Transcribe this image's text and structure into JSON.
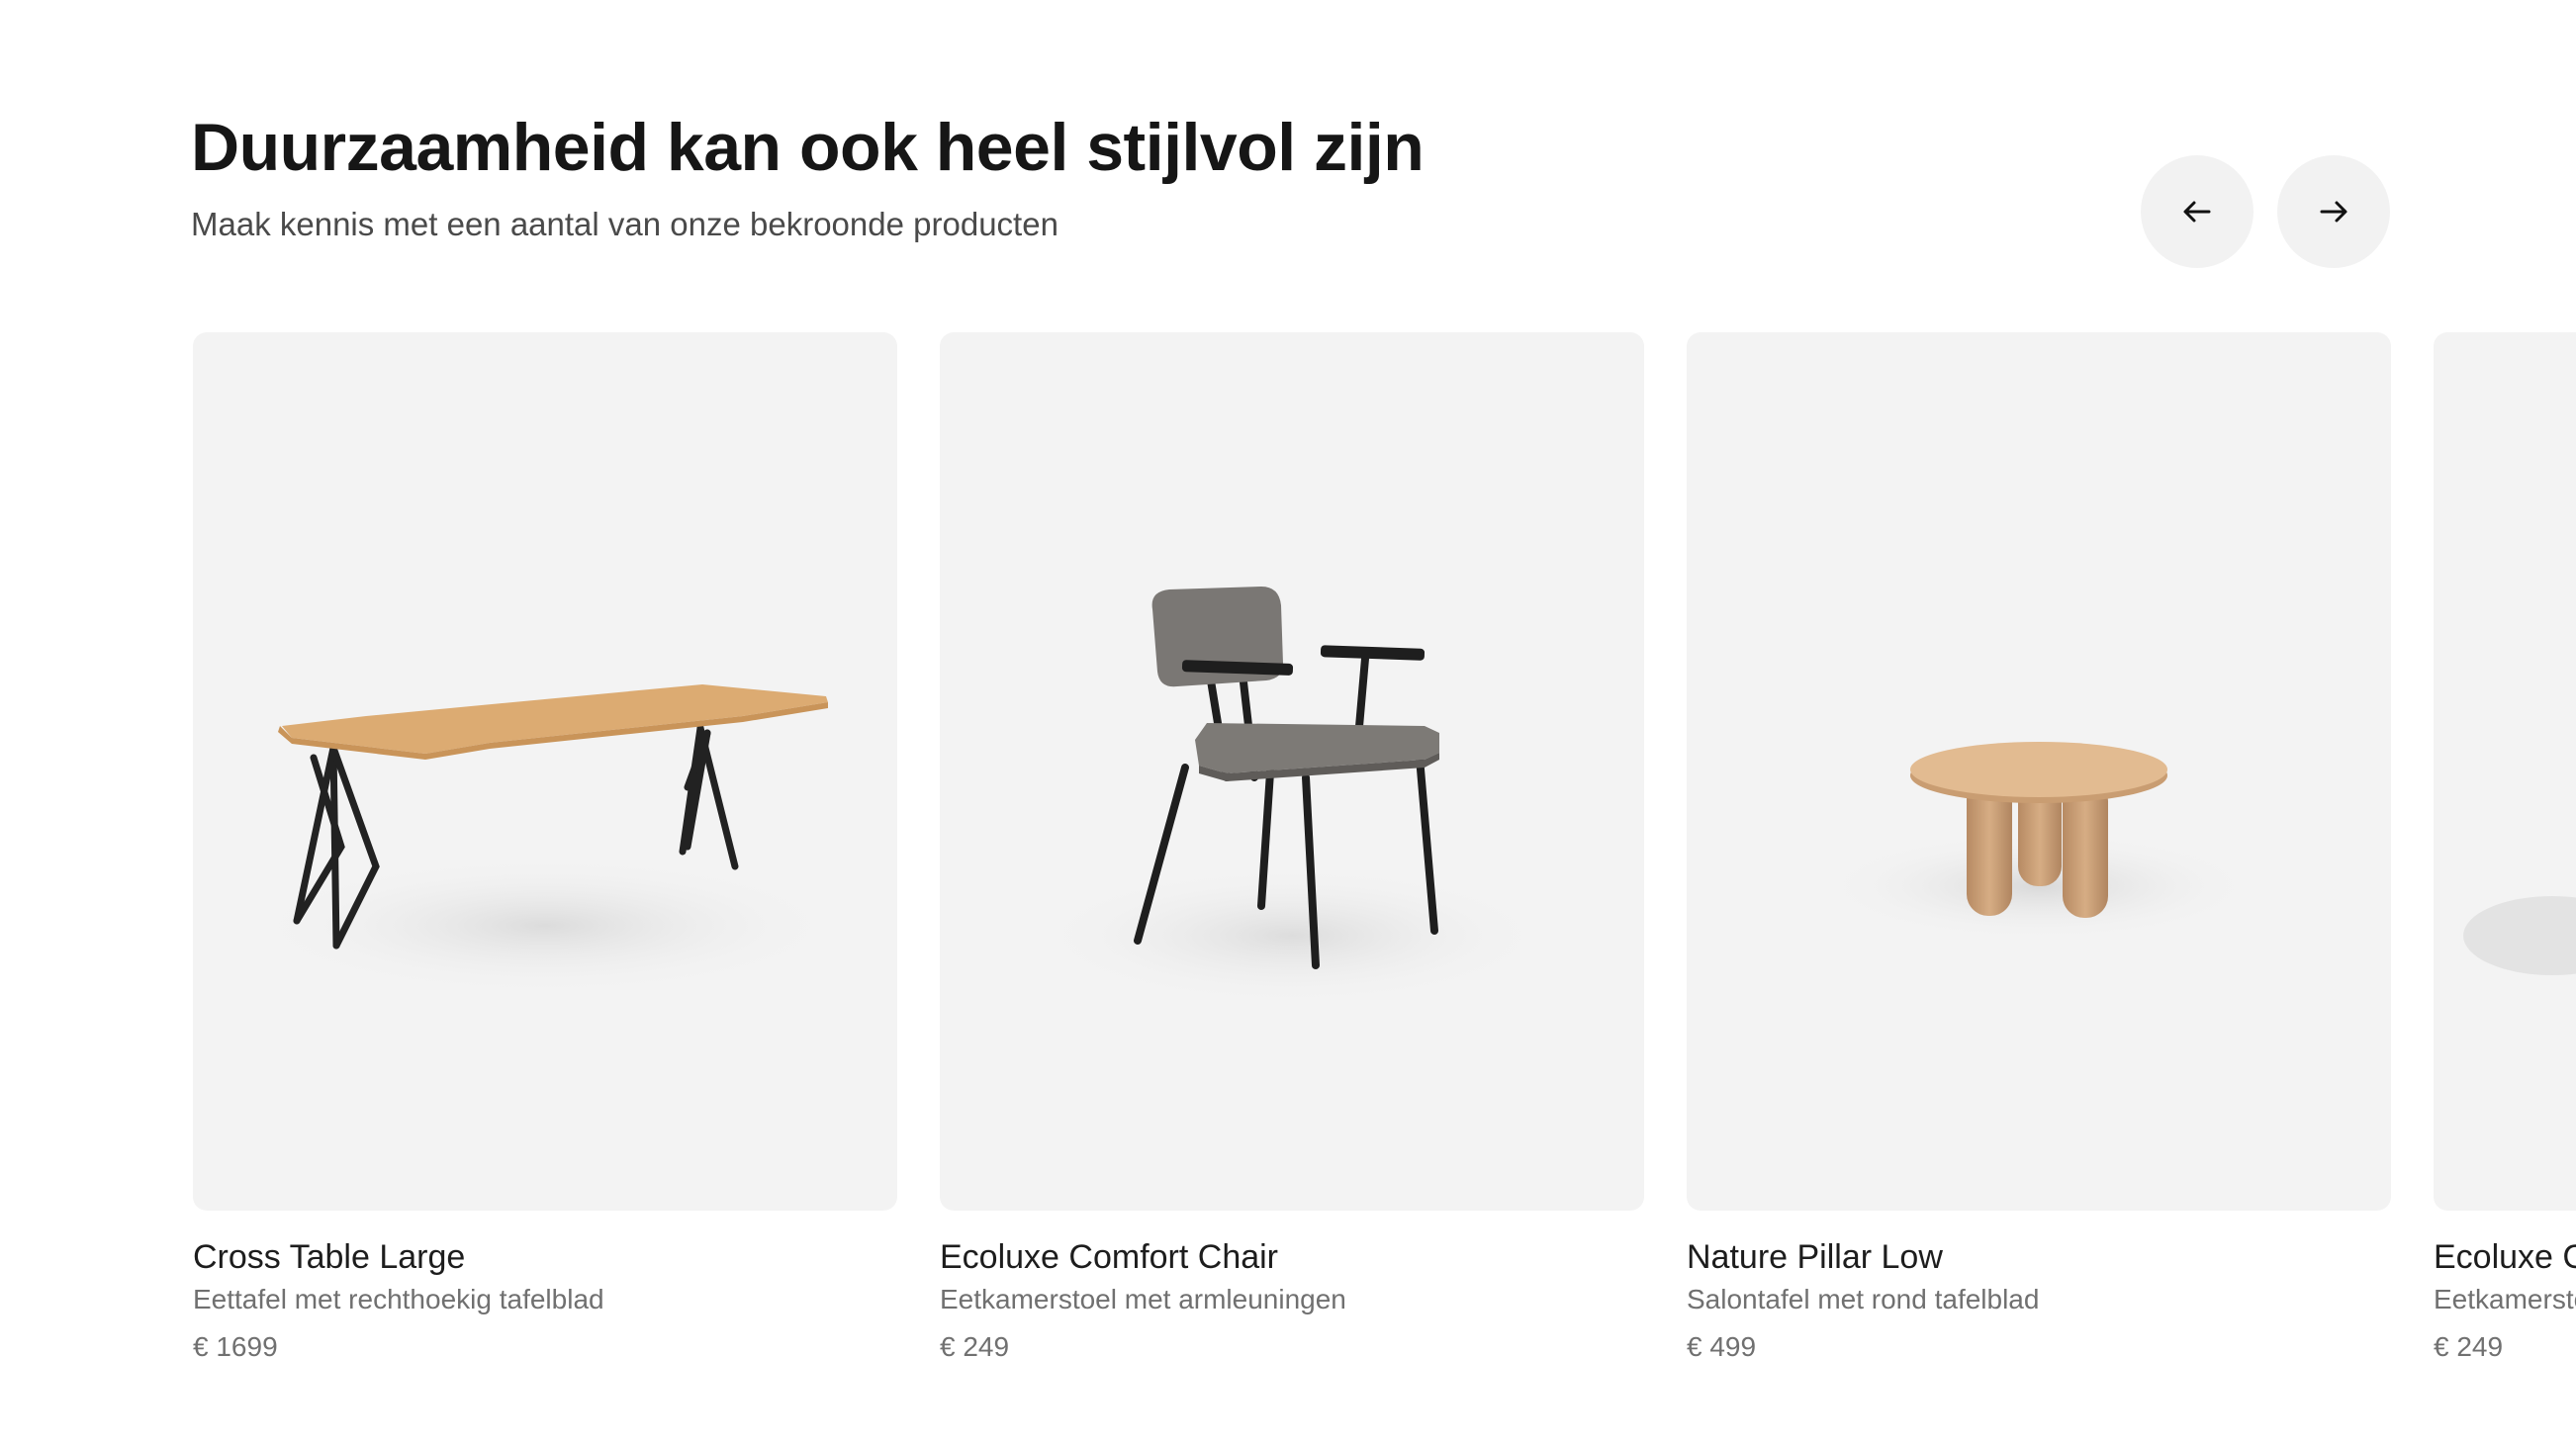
{
  "section": {
    "title": "Duurzaamheid kan ook heel stijlvol zijn",
    "subtitle": "Maak kennis met een aantal van onze bekroonde producten"
  },
  "navigation": {
    "prev_icon": "arrow-left-icon",
    "next_icon": "arrow-right-icon"
  },
  "colors": {
    "card_background": "#f3f3f3",
    "nav_button_background": "#f2f2f2",
    "wood": "#ddaa72",
    "metal": "#222222",
    "fabric": "#7a7774"
  },
  "products": [
    {
      "name": "Cross Table Large",
      "description": "Eettafel met rechthoekig tafelblad",
      "price": "€ 1699"
    },
    {
      "name": "Ecoluxe Comfort Chair",
      "description": "Eetkamerstoel met armleuningen",
      "price": "€ 249"
    },
    {
      "name": "Nature Pillar Low",
      "description": "Salontafel met rond tafelblad",
      "price": "€ 499"
    },
    {
      "name": "Ecoluxe Cl",
      "description": "Eetkamersto",
      "price": "€ 249"
    }
  ]
}
